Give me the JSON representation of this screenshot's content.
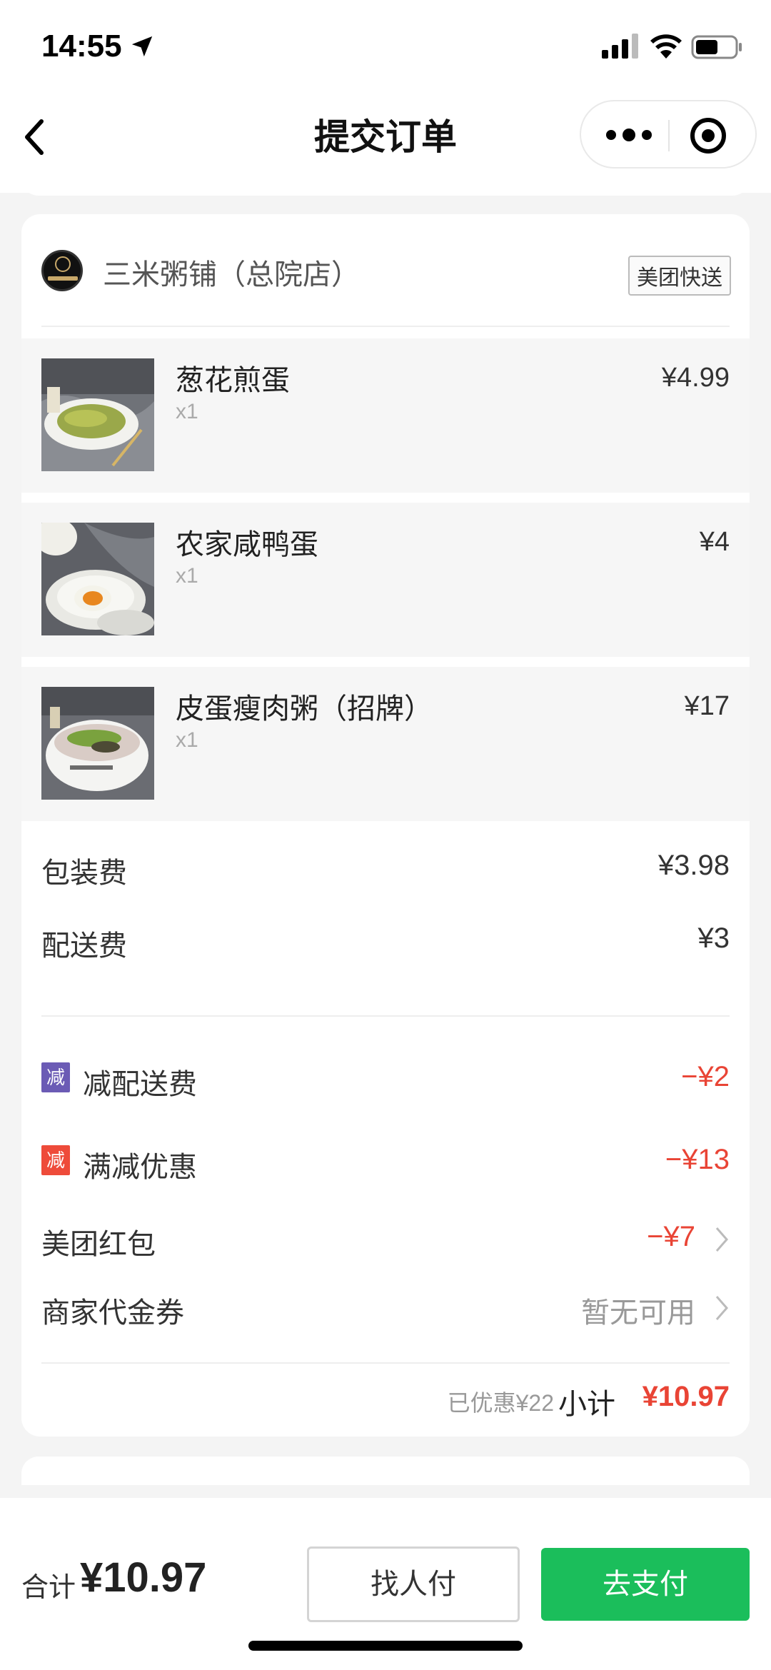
{
  "status_bar": {
    "time": "14:55"
  },
  "nav": {
    "title": "提交订单"
  },
  "shop": {
    "name": "三米粥铺（总院店）",
    "delivery_badge": "美团快送"
  },
  "items": [
    {
      "name": "葱花煎蛋",
      "qty": "x1",
      "price": "¥4.99"
    },
    {
      "name": "农家咸鸭蛋",
      "qty": "x1",
      "price": "¥4"
    },
    {
      "name": "皮蛋瘦肉粥（招牌）",
      "qty": "x1",
      "price": "¥17"
    }
  ],
  "fees": [
    {
      "label": "包装费",
      "value": "¥3.98"
    },
    {
      "label": "配送费",
      "value": "¥3"
    }
  ],
  "discounts": [
    {
      "badge": "减",
      "badge_color": "#6b5bb5",
      "label": "减配送费",
      "value": "−¥2"
    },
    {
      "badge": "减",
      "badge_color": "#ee4b3a",
      "label": "满减优惠",
      "value": "−¥13"
    }
  ],
  "red_packet": {
    "label": "美团红包",
    "value": "−¥7"
  },
  "voucher": {
    "label": "商家代金券",
    "value": "暂无可用"
  },
  "subtotal": {
    "saved": "已优惠¥22",
    "label": "小计",
    "value": "¥10.97"
  },
  "bottom": {
    "total_label": "合计",
    "total_value": "¥10.97",
    "friend_pay": "找人付",
    "pay": "去支付"
  },
  "colors": {
    "accent_red": "#e94435",
    "pay_green": "#1bbe5b"
  }
}
